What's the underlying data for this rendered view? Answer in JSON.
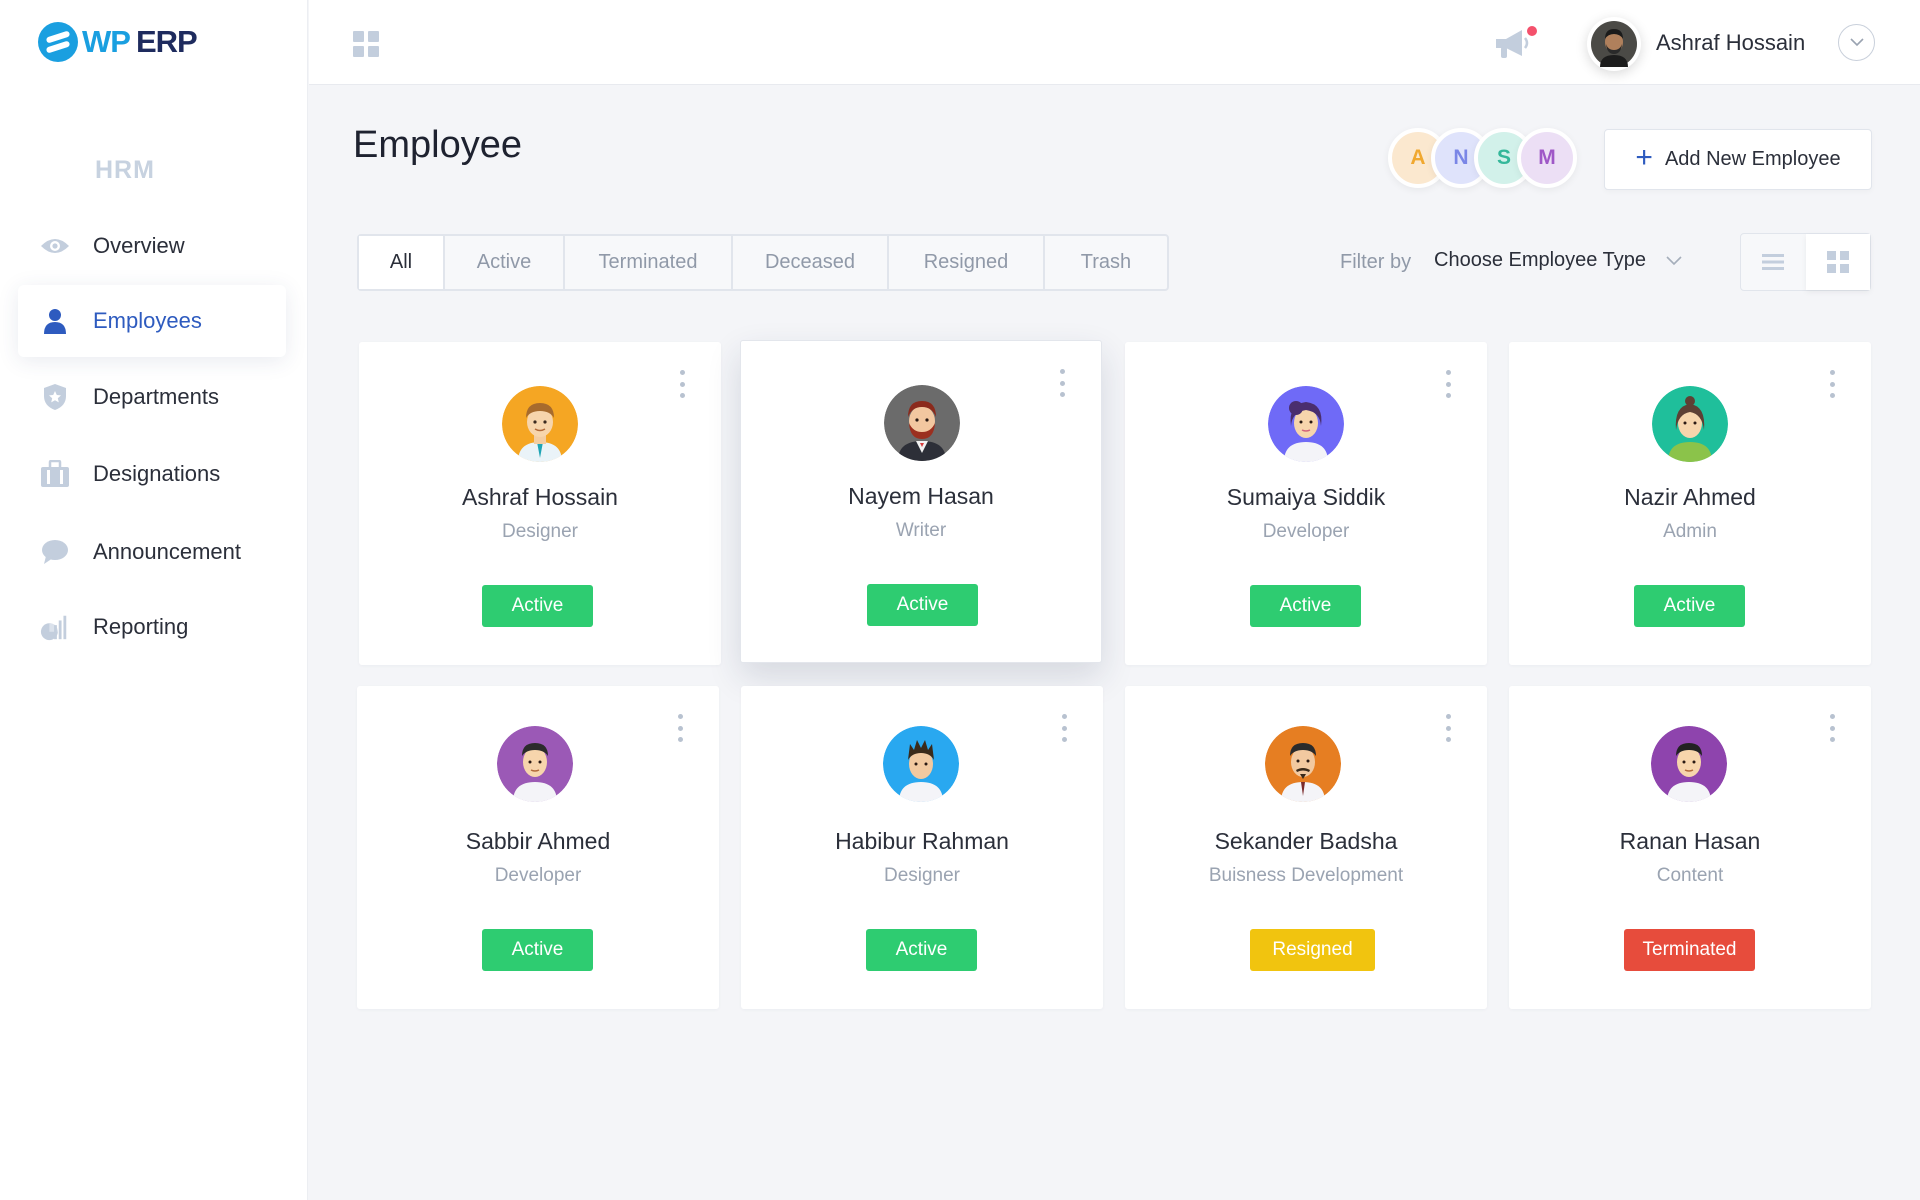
{
  "brand": {
    "wp": "WP",
    "erp": "ERP"
  },
  "sidebar": {
    "section": "HRM",
    "items": [
      {
        "label": "Overview",
        "icon": "eye-icon"
      },
      {
        "label": "Employees",
        "icon": "user-icon"
      },
      {
        "label": "Departments",
        "icon": "shield-icon"
      },
      {
        "label": "Designations",
        "icon": "briefcase-icon"
      },
      {
        "label": "Announcement",
        "icon": "chat-bubble-icon"
      },
      {
        "label": "Reporting",
        "icon": "report-chart-icon"
      }
    ]
  },
  "topbar": {
    "user_name": "Ashraf Hossain"
  },
  "page": {
    "title": "Employee",
    "add_button": "Add New Employee"
  },
  "avatar_stack": [
    "A",
    "N",
    "S",
    "M"
  ],
  "tabs": [
    "All",
    "Active",
    "Terminated",
    "Deceased",
    "Resigned",
    "Trash"
  ],
  "filter": {
    "label": "Filter by",
    "value": "Choose Employee Type"
  },
  "employees": [
    {
      "name": "Ashraf Hossain",
      "role": "Designer",
      "status": "Active"
    },
    {
      "name": "Nayem Hasan",
      "role": "Writer",
      "status": "Active"
    },
    {
      "name": "Sumaiya Siddik",
      "role": "Developer",
      "status": "Active"
    },
    {
      "name": "Nazir Ahmed",
      "role": "Admin",
      "status": "Active"
    },
    {
      "name": "Sabbir Ahmed",
      "role": "Developer",
      "status": "Active"
    },
    {
      "name": "Habibur Rahman",
      "role": "Designer",
      "status": "Active"
    },
    {
      "name": "Sekander Badsha",
      "role": "Buisness Development",
      "status": "Resigned"
    },
    {
      "name": "Ranan Hasan",
      "role": "Content",
      "status": "Terminated"
    }
  ],
  "colors": {
    "accent": "#2e5bbf",
    "active": "#2ecc71",
    "resigned": "#f1c40f",
    "terminated": "#e74c3c",
    "avatars": [
      "#f5a623",
      "#6b6b6b",
      "#6f6af7",
      "#1fbf9b",
      "#9b59b6",
      "#29a8f0",
      "#e67e22",
      "#8e44ad"
    ],
    "stack_bg": [
      "#fbe8cf",
      "#dfe3fb",
      "#d2f1ea",
      "#ecdff5"
    ],
    "stack_fg": [
      "#f0a830",
      "#7a86e6",
      "#34b79a",
      "#9f58c7"
    ]
  }
}
